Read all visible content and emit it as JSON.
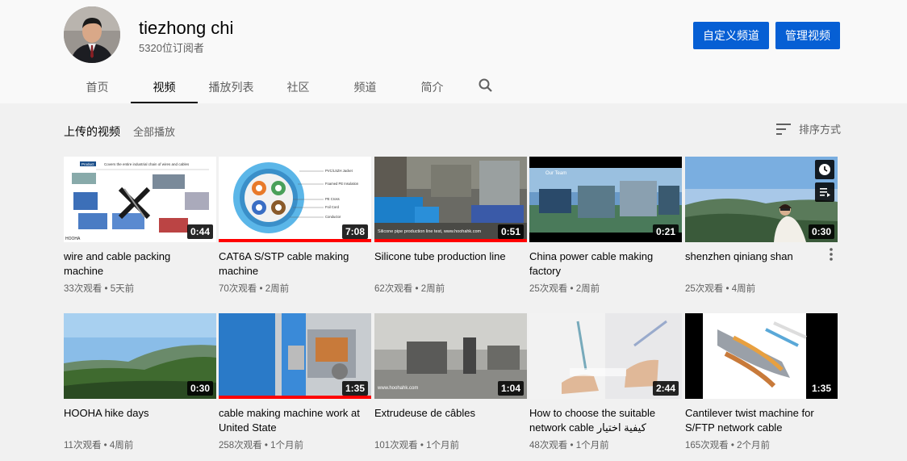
{
  "channel": {
    "name": "tiezhong chi",
    "subscribers": "5320位订阅者"
  },
  "buttons": {
    "customize": "自定义频道",
    "manage": "管理视频"
  },
  "tabs": [
    "首页",
    "视频",
    "播放列表",
    "社区",
    "频道",
    "简介"
  ],
  "active_tab": "视频",
  "section": {
    "title": "上传的视频",
    "play_all": "全部播放",
    "sort": "排序方式"
  },
  "videos": [
    {
      "title": "wire and cable packing machine",
      "duration": "0:44",
      "meta": "33次观看 • 5天前",
      "progress": 0
    },
    {
      "title": "CAT6A S/STP cable making machine",
      "duration": "7:08",
      "meta": "70次观看 • 2周前",
      "progress": 1.0
    },
    {
      "title": "Silicone tube production line",
      "duration": "0:51",
      "meta": "62次观看 • 2周前",
      "progress": 1.0
    },
    {
      "title": "China power cable making factory",
      "duration": "0:21",
      "meta": "25次观看 • 2周前",
      "progress": 0
    },
    {
      "title": "shenzhen qiniang shan",
      "duration": "0:30",
      "meta": "25次观看 • 4周前",
      "progress": 0
    },
    {
      "title": "HOOHA hike days",
      "duration": "0:30",
      "meta": "11次观看 • 4周前",
      "progress": 0
    },
    {
      "title": "cable making machine work at United State",
      "duration": "1:35",
      "meta": "258次观看 • 1个月前",
      "progress": 1.0
    },
    {
      "title": "Extrudeuse de câbles",
      "duration": "1:04",
      "meta": "101次观看 • 1个月前",
      "progress": 0
    },
    {
      "title": "How to choose the suitable network cable كيفية اختيار الخط…",
      "duration": "2:44",
      "meta": "48次观看 • 1个月前",
      "progress": 0
    },
    {
      "title": "Cantilever twist machine for S/FTP network cable",
      "duration": "1:35",
      "meta": "165次观看 • 2个月前",
      "progress": 0
    }
  ],
  "thumb_text": {
    "t1_header": "Product",
    "t1_caption": "Covers the entire industrial chain of wires and cables",
    "t1_logo": "HOOHA",
    "t2_labels": [
      "PVC/LSZH Jacket",
      "Foamed PE Insulation",
      "PE Cross",
      "Foil Cord",
      "Conductor"
    ],
    "t3_caption": "Silicone pipe production line test, www.hoohahk.com",
    "t4_banner": "Our Team",
    "t8_watermark": "www.hoohahk.com"
  },
  "colors": {
    "accent": "#065fd4",
    "progress": "#ff0000",
    "tab_active": "#030303"
  }
}
